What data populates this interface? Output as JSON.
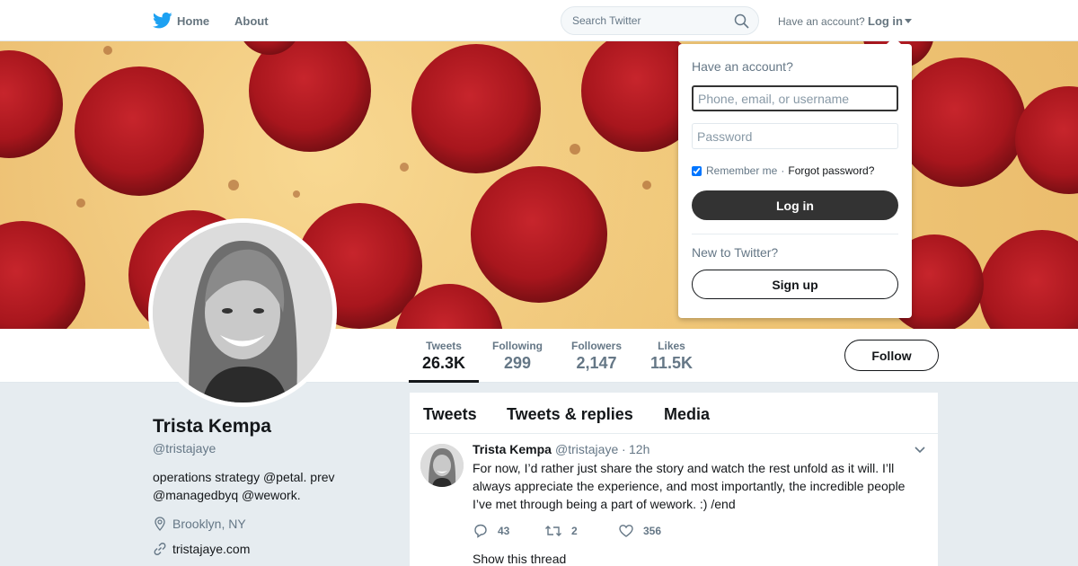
{
  "nav": {
    "home_label": "Home",
    "about_label": "About",
    "search_placeholder": "Search Twitter",
    "have_account": "Have an account?",
    "login_label": "Log in",
    "brand_color": "#1da1f2"
  },
  "profile": {
    "name": "Trista Kempa",
    "handle": "@tristajaye",
    "bio": "operations strategy @petal. prev @managedbyq @wework.",
    "location": "Brooklyn, NY",
    "website": "tristajaye.com",
    "follow_label": "Follow"
  },
  "stats": [
    {
      "label": "Tweets",
      "value": "26.3K",
      "active": true
    },
    {
      "label": "Following",
      "value": "299"
    },
    {
      "label": "Followers",
      "value": "2,147"
    },
    {
      "label": "Likes",
      "value": "11.5K"
    }
  ],
  "timeline": {
    "tabs": [
      "Tweets",
      "Tweets & replies",
      "Media"
    ],
    "tweet": {
      "name": "Trista Kempa",
      "handle": "@tristajaye",
      "dot": "·",
      "time": "12h",
      "text": "For now, I’d rather just share the story and watch the rest unfold as it will. I’ll always appreciate the experience, and most importantly, the incredible people I’ve met through being a part of wework. :) /end",
      "replies": "43",
      "retweets": "2",
      "likes": "356",
      "show_thread": "Show this thread"
    }
  },
  "login_dropdown": {
    "title": "Have an account?",
    "username_placeholder": "Phone, email, or username",
    "password_placeholder": "Password",
    "remember_label": "Remember me",
    "separator": "·",
    "forgot_label": "Forgot password?",
    "login_button": "Log in",
    "new_label": "New to Twitter?",
    "signup_button": "Sign up"
  }
}
